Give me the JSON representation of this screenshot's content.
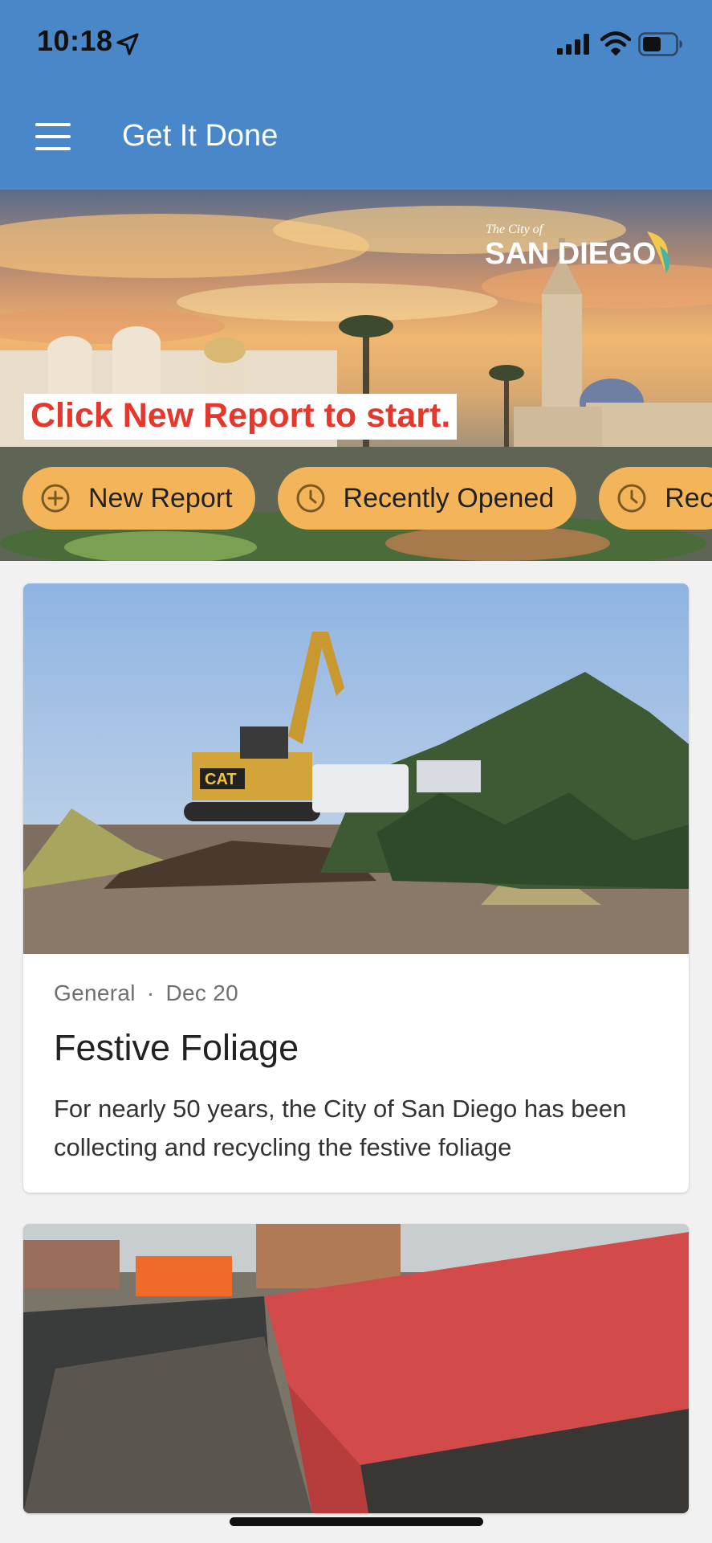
{
  "status_bar": {
    "time": "10:18",
    "icons": [
      "location-arrow-icon",
      "cellular-signal-icon",
      "wifi-icon",
      "battery-icon"
    ]
  },
  "app_bar": {
    "title": "Get It Done",
    "menu_icon": "hamburger-menu-icon",
    "color": "#4a87c8"
  },
  "hero": {
    "logo_small": "The City of",
    "logo_large": "SAN DIEGO",
    "cta_text": "Click New Report to start.",
    "chips": [
      {
        "label": "New Report",
        "icon": "plus-circle-icon"
      },
      {
        "label": "Recently Opened",
        "icon": "clock-icon"
      },
      {
        "label": "Rec",
        "icon": "clock-icon"
      }
    ],
    "chip_color": "#f4b55a",
    "cta_color": "#e5372c"
  },
  "feed": [
    {
      "category": "General",
      "separator": "·",
      "date": "Dec 20",
      "title": "Festive Foliage",
      "summary": "For nearly 50 years, the City of San Diego has been collecting and recycling the festive foliage"
    },
    {
      "category": "",
      "date": "",
      "title": "",
      "summary": ""
    }
  ]
}
